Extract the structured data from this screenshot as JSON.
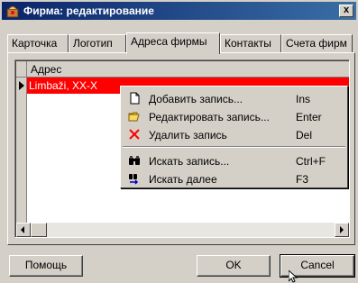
{
  "window": {
    "title": "Фирма: редактирование",
    "close_label": "x"
  },
  "tabs": [
    {
      "label": "Карточка"
    },
    {
      "label": "Логотип"
    },
    {
      "label": "Адреса фирмы"
    },
    {
      "label": "Контакты"
    },
    {
      "label": "Счета фирм"
    }
  ],
  "active_tab": "Адреса фирмы",
  "grid": {
    "column_header": "Адрес",
    "rows": [
      {
        "address": "Limbaži, XX-X"
      }
    ]
  },
  "context_menu": {
    "items": [
      {
        "icon": "new-record-icon",
        "label": "Добавить запись...",
        "shortcut": "Ins"
      },
      {
        "icon": "edit-record-icon",
        "label": "Редактировать запись...",
        "shortcut": "Enter"
      },
      {
        "icon": "delete-record-icon",
        "label": "Удалить запись",
        "shortcut": "Del"
      },
      {
        "icon": "binoculars-icon",
        "label": "Искать запись...",
        "shortcut": "Ctrl+F"
      },
      {
        "icon": "find-next-icon",
        "label": "Искать далее",
        "shortcut": "F3"
      }
    ]
  },
  "buttons": {
    "help": "Помощь",
    "ok": "OK",
    "cancel": "Cancel"
  },
  "colors": {
    "selection": "#ff0000",
    "title_bar": "#0a246a",
    "face": "#d4d0c8"
  }
}
